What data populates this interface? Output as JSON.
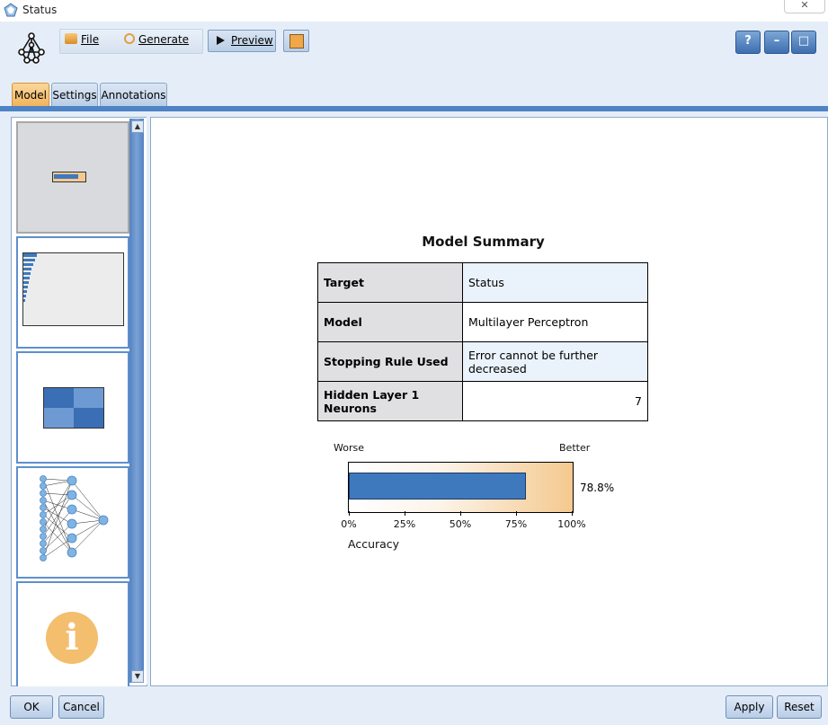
{
  "window": {
    "title": "Status"
  },
  "toolbar": {
    "file_label": "File",
    "generate_label": "Generate",
    "preview_label": "Preview",
    "help_label": "?",
    "minimize_label": "–",
    "maximize_label": "□"
  },
  "tabs": [
    {
      "label": "Model",
      "active": true
    },
    {
      "label": "Settings",
      "active": false
    },
    {
      "label": "Annotations",
      "active": false
    }
  ],
  "thumbnails": [
    "model-summary",
    "predictor-importance",
    "classification",
    "network",
    "information"
  ],
  "summary": {
    "title": "Model Summary",
    "rows": [
      {
        "label": "Target",
        "value": "Status"
      },
      {
        "label": "Model",
        "value": "Multilayer Perceptron"
      },
      {
        "label": "Stopping Rule Used",
        "value": "Error cannot be further decreased"
      },
      {
        "label": "Hidden Layer 1 Neurons",
        "value": "7"
      }
    ]
  },
  "chart_data": {
    "type": "bar",
    "xlabel": "Accuracy",
    "left_label": "Worse",
    "right_label": "Better",
    "ticks": [
      "0%",
      "25%",
      "50%",
      "75%",
      "100%"
    ],
    "xlim": [
      0,
      100
    ],
    "value": 78.8,
    "value_label": "78.8%",
    "bar_color": "#3e79bd",
    "gradient_end_color": "#f4c98f"
  },
  "footer": {
    "ok_label": "OK",
    "cancel_label": "Cancel",
    "apply_label": "Apply",
    "reset_label": "Reset"
  }
}
